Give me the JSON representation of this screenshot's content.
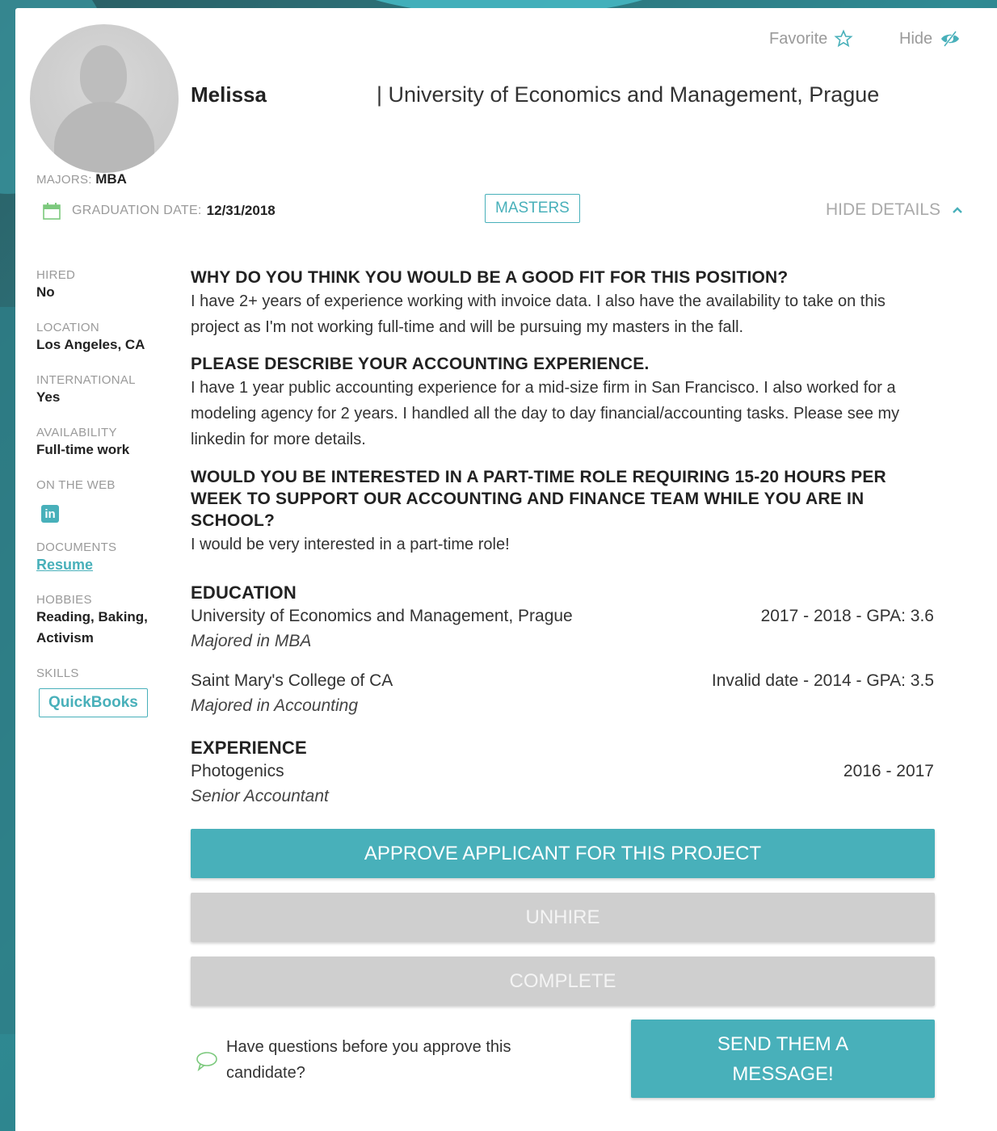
{
  "colors": {
    "accent": "#48b0ba",
    "disabled": "#cfcfcf"
  },
  "header": {
    "favorite_label": "Favorite",
    "hide_label": "Hide",
    "name": "Melissa",
    "school": "| University of Economics and Management, Prague",
    "majors_label": "MAJORS:",
    "majors_value": "MBA",
    "grad_label": "GRADUATION DATE:",
    "grad_value": "12/31/2018",
    "degree_badge": "MASTERS",
    "hide_details_label": "HIDE DETAILS"
  },
  "sidebar": {
    "hired_label": "HIRED",
    "hired_value": "No",
    "location_label": "LOCATION",
    "location_value": "Los Angeles, CA",
    "international_label": "INTERNATIONAL",
    "international_value": "Yes",
    "availability_label": "AVAILABILITY",
    "availability_value": "Full-time work",
    "web_label": "ON THE WEB",
    "documents_label": "DOCUMENTS",
    "resume_link": "Resume",
    "hobbies_label": "HOBBIES",
    "hobbies_line1": "Reading, Baking,",
    "hobbies_line2": "Activism",
    "skills_label": "SKILLS",
    "skills": [
      "QuickBooks"
    ]
  },
  "questions": [
    {
      "q": "WHY DO YOU THINK YOU WOULD BE A GOOD FIT FOR THIS POSITION?",
      "a": "I have 2+ years of experience working with invoice data. I also have the availability to take on this project as I'm not working full-time and will be pursuing my masters in the fall."
    },
    {
      "q": "PLEASE DESCRIBE YOUR ACCOUNTING EXPERIENCE.",
      "a": "I have 1 year public accounting experience for a mid-size firm in San Francisco. I also worked for a modeling agency for 2 years. I handled all the day to day financial/accounting tasks. Please see my linkedin for more details."
    },
    {
      "q": "WOULD YOU BE INTERESTED IN A PART-TIME ROLE REQUIRING 15-20 HOURS PER WEEK TO SUPPORT OUR ACCOUNTING AND FINANCE TEAM WHILE YOU ARE IN SCHOOL?",
      "a": "I would be very interested in a part-time role!"
    }
  ],
  "education": {
    "heading": "EDUCATION",
    "items": [
      {
        "school": "University of Economics and Management, Prague",
        "dates": "2017 - 2018 - GPA: 3.6",
        "major": "Majored in MBA"
      },
      {
        "school": "Saint Mary's College of CA",
        "dates": "Invalid date - 2014 - GPA: 3.5",
        "major": "Majored in Accounting"
      }
    ]
  },
  "experience": {
    "heading": "EXPERIENCE",
    "items": [
      {
        "company": "Photogenics",
        "dates": "2016 - 2017",
        "title": "Senior Accountant"
      }
    ]
  },
  "actions": {
    "approve": "APPROVE APPLICANT FOR THIS PROJECT",
    "unhire": "UNHIRE",
    "complete": "COMPLETE",
    "question_line1": "Have questions before you approve this",
    "question_line2": "candidate?",
    "message_line1": "SEND THEM A",
    "message_line2": "MESSAGE!"
  }
}
